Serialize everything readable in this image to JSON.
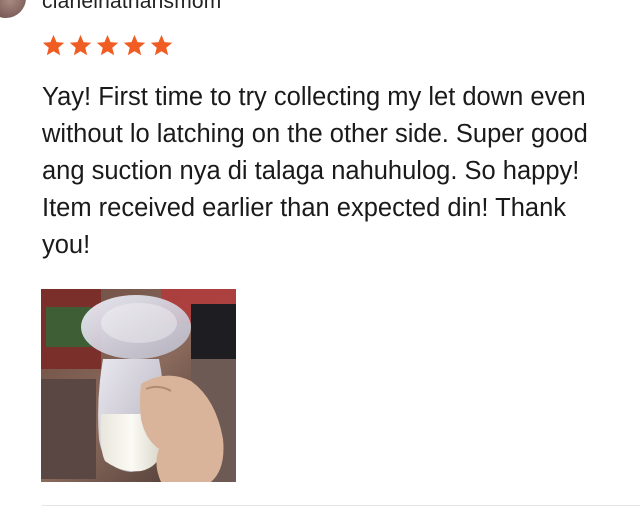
{
  "review": {
    "username": "cianelnathansmom",
    "rating": 5,
    "star_color": "#f05d23",
    "text": "Yay! First time to try collecting my let down even\nwithout lo latching on the other side. Super good\nang suction nya di talaga nahuhulog. So happy!\nItem received earlier than expected din! Thank\nyou!"
  }
}
